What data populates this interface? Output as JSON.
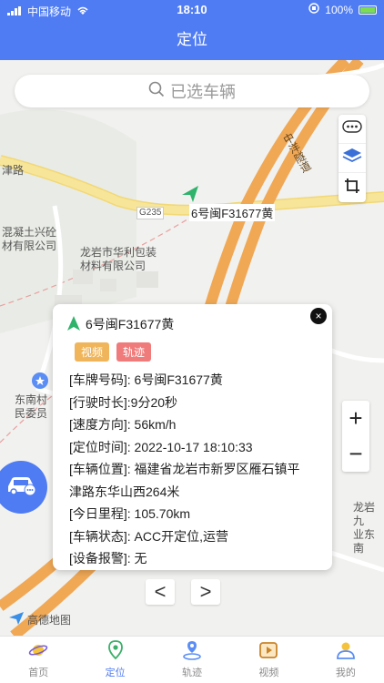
{
  "status_bar": {
    "carrier": "中国移动",
    "time": "18:10",
    "battery": "100%"
  },
  "header": {
    "title": "定位"
  },
  "search": {
    "placeholder": "已选车辆"
  },
  "map": {
    "labels": {
      "road_left": "津路",
      "tunnel": "中洋隧道",
      "road_code": "G235",
      "company1_line1": "混凝土兴砼",
      "company1_line2": "材有限公司",
      "company2_line1": "龙岩市华利包装",
      "company2_line2": "材料有限公司",
      "village_line1": "东南村",
      "village_line2": "民委员",
      "right_line1": "龙岩九",
      "right_line2": "业东南"
    },
    "vehicle_label": "6号闽F31677黄",
    "zoom": {
      "in": "+",
      "out": "−"
    },
    "logo": "高德地图"
  },
  "popup": {
    "plate": "6号闽F31677黄",
    "tags": {
      "video": "视频",
      "track": "轨迹"
    },
    "rows": [
      "[车牌号码]: 6号闽F31677黄",
      "[行驶时长]:9分20秒",
      "[速度方向]: 56km/h",
      "[定位时间]: 2022-10-17 18:10:33",
      "[车辆位置]: 福建省龙岩市新罗区雁石镇平",
      "津路东华山西264米",
      "[今日里程]: 105.70km",
      "[车辆状态]: ACC开定位,运营",
      "[设备报警]: 无"
    ],
    "close": "×",
    "prev": "<",
    "next": ">"
  },
  "tabbar": {
    "items": [
      {
        "label": "首页",
        "icon": "planet-icon"
      },
      {
        "label": "定位",
        "icon": "location-pin-icon"
      },
      {
        "label": "轨迹",
        "icon": "track-pin-icon"
      },
      {
        "label": "视频",
        "icon": "video-icon"
      },
      {
        "label": "我的",
        "icon": "user-icon"
      }
    ],
    "active_index": 1
  },
  "colors": {
    "primary": "#4f7cf3",
    "road_orange": "#f5a24a",
    "road_yellow": "#f6e089"
  }
}
